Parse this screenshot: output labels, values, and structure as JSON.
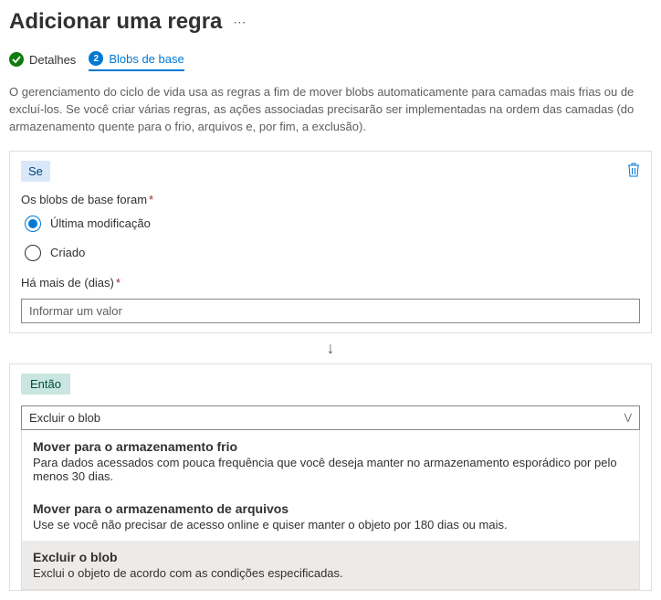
{
  "header": {
    "title": "Adicionar uma regra"
  },
  "steps": {
    "details": "Detalhes",
    "baseBlobs": "Blobs de base",
    "stepNumber": "2"
  },
  "description": "O gerenciamento do ciclo de vida usa as regras a fim de mover blobs automaticamente para camadas mais frias ou de excluí-los. Se você criar várias regras, as ações associadas precisarão ser implementadas na ordem das camadas (do armazenamento quente para o frio, arquivos e, por fim, a exclusão).",
  "ifSection": {
    "tag": "Se",
    "conditionLabel": "Os blobs de base foram",
    "radios": {
      "lastModified": "Última modificação",
      "created": "Criado"
    },
    "daysLabel": "Há mais de (dias)",
    "daysPlaceholder": "Informar um valor"
  },
  "thenSection": {
    "tag": "Então",
    "selectedAction": "Excluir o blob"
  },
  "dropdown": {
    "options": [
      {
        "title": "Mover para o armazenamento frio",
        "desc": "Para dados acessados com pouca frequência que você deseja manter no armazenamento esporádico por pelo menos 30 dias."
      },
      {
        "title": "Mover para o armazenamento de arquivos",
        "desc": "Use se você não precisar de acesso online e quiser manter o objeto por 180 dias ou mais."
      },
      {
        "title": "Excluir o blob",
        "desc": "Exclui o objeto de acordo com as condições especificadas."
      }
    ]
  }
}
